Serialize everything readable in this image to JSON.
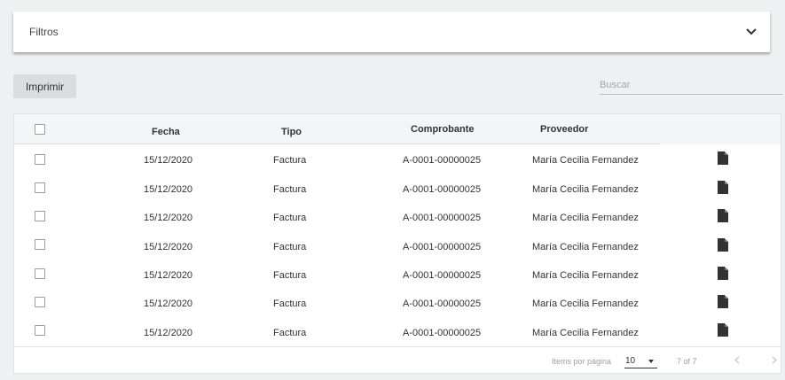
{
  "filters": {
    "title": "Filtros",
    "toggle_icon": "chevron-down-icon"
  },
  "toolbar": {
    "print_label": "Imprimir"
  },
  "search": {
    "placeholder": "Buscar",
    "value": ""
  },
  "table": {
    "columns": [
      "Fecha",
      "Tipo",
      "Comprobante",
      "Proveedor"
    ],
    "rows": [
      {
        "fecha": "15/12/2020",
        "tipo": "Factura",
        "comprobante": "A-0001-00000025",
        "proveedor": "María Cecilia Fernandez",
        "icon": "document-icon"
      },
      {
        "fecha": "15/12/2020",
        "tipo": "Factura",
        "comprobante": "A-0001-00000025",
        "proveedor": "María Cecilia Fernandez",
        "icon": "document-icon"
      },
      {
        "fecha": "15/12/2020",
        "tipo": "Factura",
        "comprobante": "A-0001-00000025",
        "proveedor": "María Cecilia Fernandez",
        "icon": "document-icon"
      },
      {
        "fecha": "15/12/2020",
        "tipo": "Factura",
        "comprobante": "A-0001-00000025",
        "proveedor": "María Cecilia Fernandez",
        "icon": "document-icon"
      },
      {
        "fecha": "15/12/2020",
        "tipo": "Factura",
        "comprobante": "A-0001-00000025",
        "proveedor": "María Cecilia Fernandez",
        "icon": "document-icon"
      },
      {
        "fecha": "15/12/2020",
        "tipo": "Factura",
        "comprobante": "A-0001-00000025",
        "proveedor": "María Cecilia Fernandez",
        "icon": "document-icon"
      },
      {
        "fecha": "15/12/2020",
        "tipo": "Factura",
        "comprobante": "A-0001-00000025",
        "proveedor": "María Cecilia Fernandez",
        "icon": "document-icon"
      }
    ]
  },
  "pagination": {
    "items_per_page_label": "Items por página",
    "items_per_page_value": "10",
    "range_label": "7 of 7"
  },
  "colors": {
    "background": "#eef0f1",
    "header_bg": "#f4f5f6",
    "button_bg": "#dadcde",
    "icon": "#333333"
  }
}
